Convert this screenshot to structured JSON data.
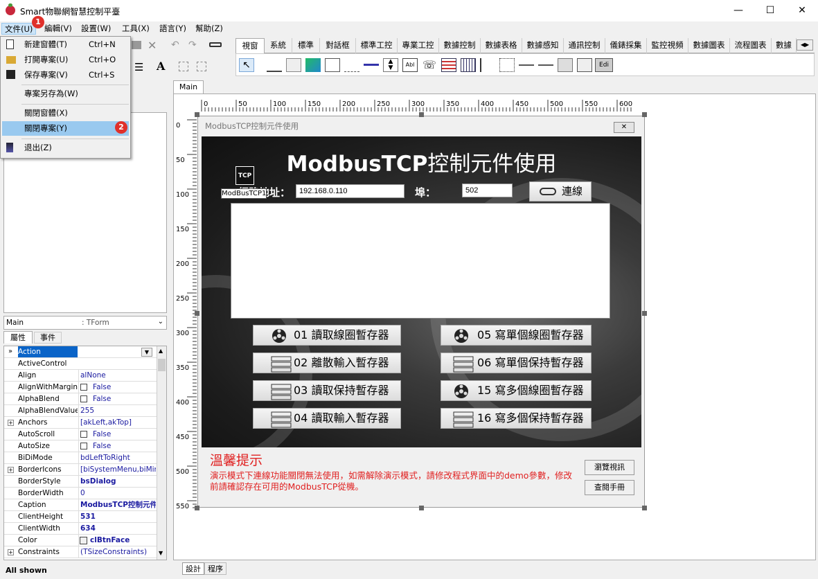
{
  "window": {
    "title": "Smart物聯網智慧控制平臺",
    "min": "—",
    "max": "☐",
    "close": "✕"
  },
  "menu": [
    "文件(U)",
    "編輯(V)",
    "設置(W)",
    "工具(X)",
    "語言(Y)",
    "幫助(Z)"
  ],
  "file_menu": {
    "items": [
      {
        "label": "新建窗體(T)",
        "shortcut": "Ctrl+N",
        "icon": "new-file-icon"
      },
      {
        "label": "打開專案(U)",
        "shortcut": "Ctrl+O",
        "icon": "open-folder-icon"
      },
      {
        "label": "保存專案(V)",
        "shortcut": "Ctrl+S",
        "icon": "save-icon"
      },
      {
        "label": "專案另存為(W)",
        "shortcut": "",
        "icon": ""
      },
      {
        "label": "關閉窗體(X)",
        "shortcut": "",
        "icon": ""
      },
      {
        "label": "關閉專案(Y)",
        "shortcut": "",
        "icon": "",
        "highlighted": true
      },
      {
        "label": "退出(Z)",
        "shortcut": "",
        "icon": "exit-icon"
      }
    ]
  },
  "badges": [
    "1",
    "2"
  ],
  "component_tabs": [
    "視窗",
    "系統",
    "標準",
    "對話框",
    "標準工控",
    "專業工控",
    "數據控制",
    "數據表格",
    "數據感知",
    "通訊控制",
    "儀錶採集",
    "監控視頻",
    "數據圖表",
    "流程圖表",
    "數據"
  ],
  "design_tab": "Main",
  "object_combo": {
    "name": "Main",
    "type": ": TForm"
  },
  "inspector_tabs": [
    "屬性",
    "事件"
  ],
  "properties": [
    {
      "name": "Action",
      "value": "",
      "selected": true
    },
    {
      "name": "ActiveControl",
      "value": ""
    },
    {
      "name": "Align",
      "value": "alNone"
    },
    {
      "name": "AlignWithMargins",
      "value": "False"
    },
    {
      "name": "AlphaBlend",
      "value": "False"
    },
    {
      "name": "AlphaBlendValue",
      "value": "255"
    },
    {
      "name": "Anchors",
      "value": "[akLeft,akTop]"
    },
    {
      "name": "AutoScroll",
      "value": "False"
    },
    {
      "name": "AutoSize",
      "value": "False"
    },
    {
      "name": "BiDiMode",
      "value": "bdLeftToRight"
    },
    {
      "name": "BorderIcons",
      "value": "[biSystemMenu,biMinim"
    },
    {
      "name": "BorderStyle",
      "value": "bsDialog"
    },
    {
      "name": "BorderWidth",
      "value": "0"
    },
    {
      "name": "Caption",
      "value": "ModbusTCP控制元件"
    },
    {
      "name": "ClientHeight",
      "value": "531"
    },
    {
      "name": "ClientWidth",
      "value": "634"
    },
    {
      "name": "Color",
      "value": "clBtnFace"
    },
    {
      "name": "Constraints",
      "value": "(TSizeConstraints)"
    }
  ],
  "status": "All shown",
  "bottom_tabs": [
    "設計",
    "程序"
  ],
  "ruler_top": [
    "0",
    "50",
    "100",
    "150",
    "200",
    "250",
    "300",
    "350",
    "400",
    "450",
    "500",
    "550",
    "600"
  ],
  "ruler_left": [
    "0",
    "50",
    "100",
    "150",
    "200",
    "250",
    "300",
    "350",
    "400",
    "450",
    "500",
    "550"
  ],
  "form": {
    "caption": "ModbusTCP控制元件使用",
    "close": "✕",
    "heading_bold": "ModbusTCP",
    "heading_rest": "控制元件使用",
    "tcp_icon_text": "TCP",
    "tcp_component_label": "ModBusTCP1",
    "ip_label": "網路地址：",
    "ip_value": "192.168.0.110",
    "port_label": "埠：",
    "port_value": "502",
    "connect_label": "連線",
    "buttons_left": [
      {
        "label": "01 讀取線圈暫存器",
        "icon": "reel-icon"
      },
      {
        "label": "02 離散輸入暫存器",
        "icon": "server-icon"
      },
      {
        "label": "03 讀取保持暫存器",
        "icon": "server-icon"
      },
      {
        "label": "04 讀取輸入暫存器",
        "icon": "server-icon"
      }
    ],
    "buttons_right": [
      {
        "label": "05 寫單個線圈暫存器",
        "icon": "reel-icon"
      },
      {
        "label": "06 寫單個保持暫存器",
        "icon": "server-icon"
      },
      {
        "label": "15 寫多個線圈暫存器",
        "icon": "reel-icon"
      },
      {
        "label": "16 寫多個保持暫存器",
        "icon": "server-icon"
      }
    ],
    "notice_title": "溫馨提示",
    "notice_body": "演示模式下連線功能關閉無法使用，如需解除演示模式，請修改程式界面中的demo參數，修改前請確認存在可用的ModbusTCP從機。",
    "btn_video": "瀏覽視訊",
    "btn_manual": "查閱手冊"
  },
  "colors": {
    "accent": "#99c9ef",
    "notice": "#e02020",
    "badge": "#e0302a"
  }
}
